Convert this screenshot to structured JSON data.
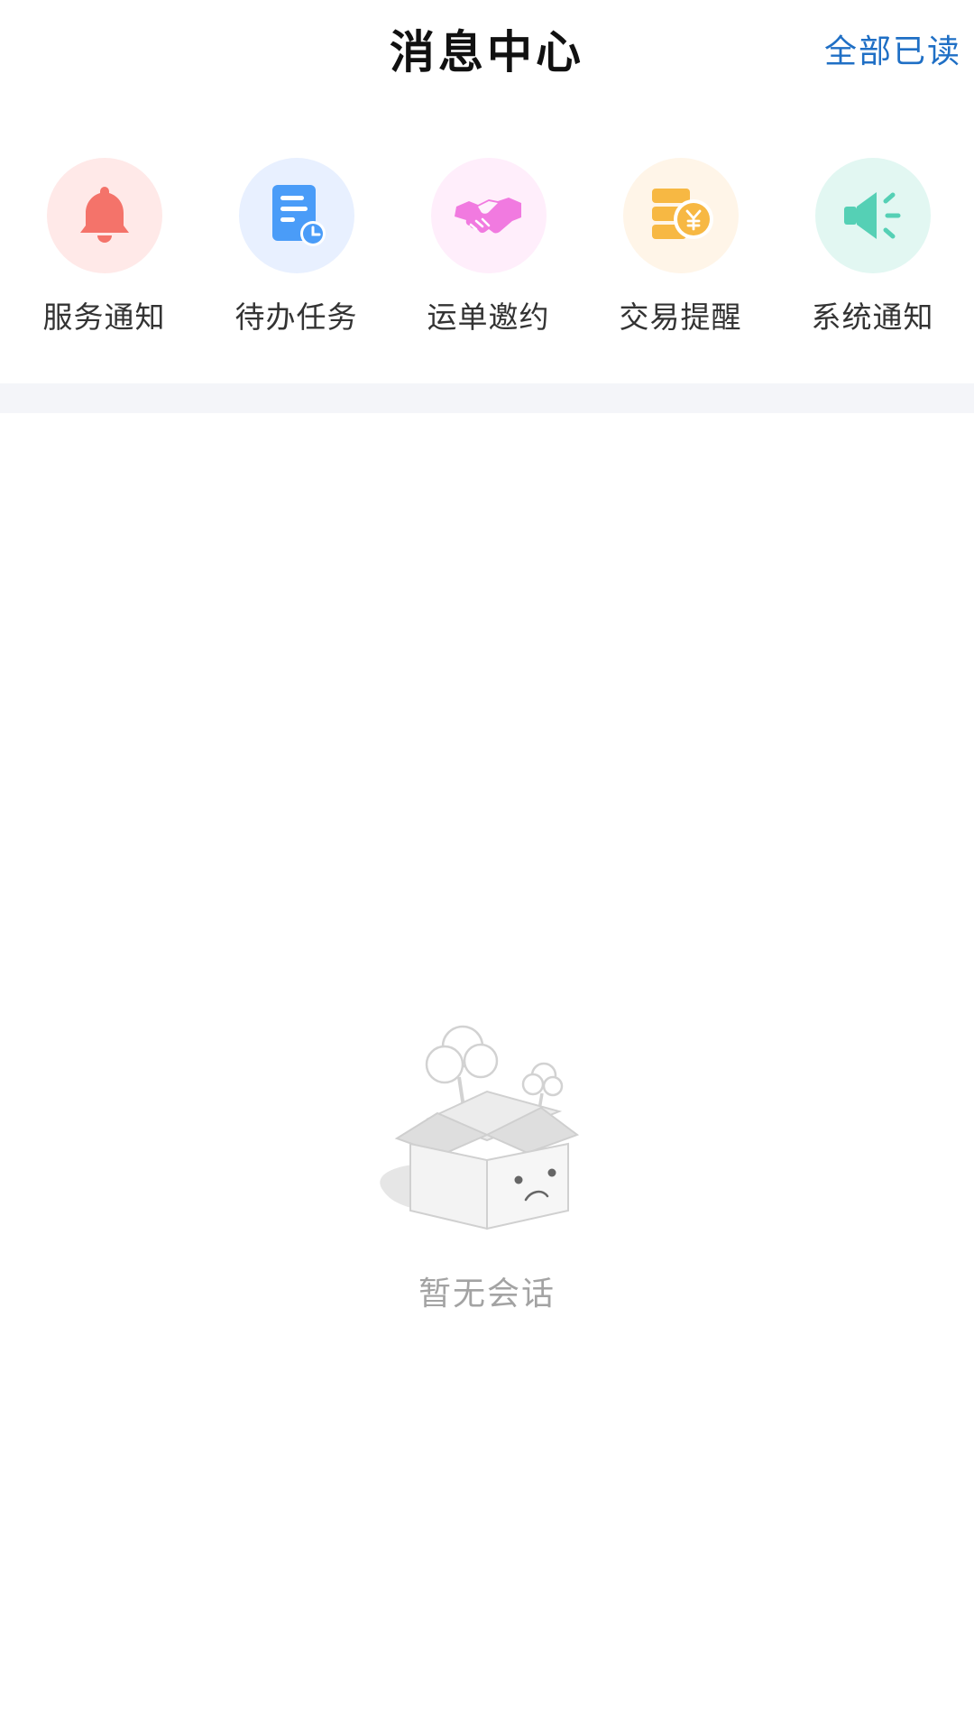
{
  "header": {
    "title": "消息中心",
    "mark_all_read": "全部已读"
  },
  "categories": [
    {
      "label": "服务通知",
      "icon": "bell-icon",
      "bg": "#ffe9e8",
      "color": "#f4736a"
    },
    {
      "label": "待办任务",
      "icon": "todo-document-clock-icon",
      "bg": "#e8f0ff",
      "color": "#4a9cf8"
    },
    {
      "label": "运单邀约",
      "icon": "handshake-icon",
      "bg": "#ffeefb",
      "color": "#f17ae0"
    },
    {
      "label": "交易提醒",
      "icon": "coin-stack-yen-icon",
      "bg": "#fff5e8",
      "color": "#f7b843"
    },
    {
      "label": "系统通知",
      "icon": "megaphone-icon",
      "bg": "#e2f7f2",
      "color": "#55d0b5"
    }
  ],
  "empty_state": {
    "text": "暂无会话",
    "illustration": "empty-box-icon"
  }
}
